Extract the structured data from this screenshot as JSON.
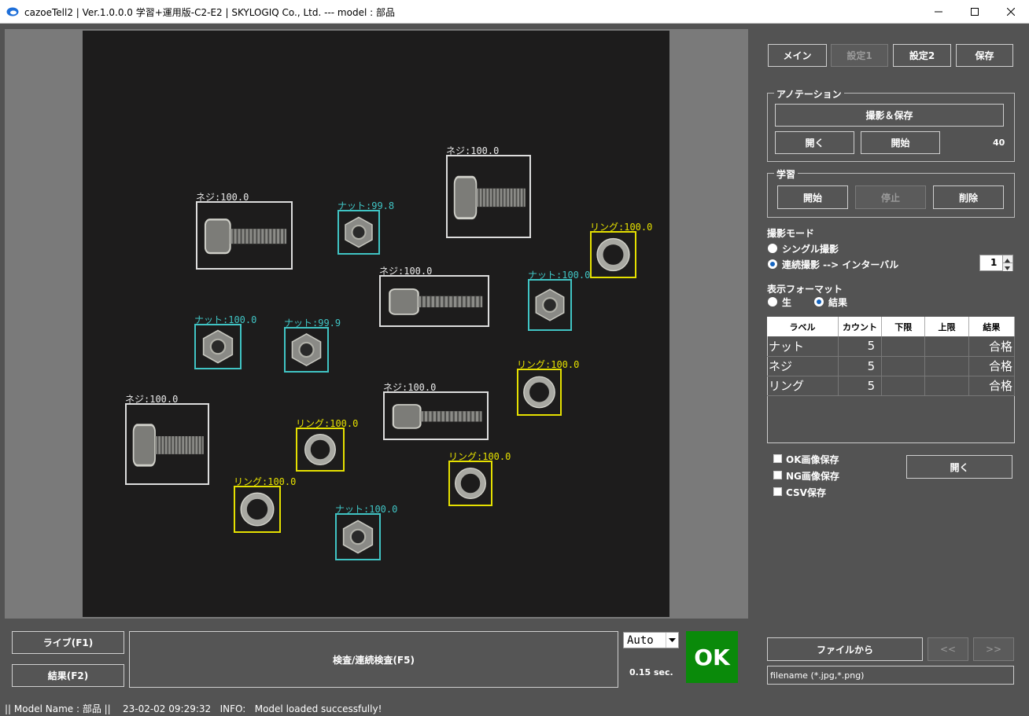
{
  "window": {
    "title": "cazoeTell2 | Ver.1.0.0.0 学習+運用版-C2-E2 | SKYLOGIQ Co., Ltd. --- model : 部品"
  },
  "detections": [
    {
      "label": "ネジ:100.0",
      "kind": "screw"
    },
    {
      "label": "ナット:99.8",
      "kind": "nut"
    },
    {
      "label": "ネジ:100.0",
      "kind": "screw"
    },
    {
      "label": "リング:100.0",
      "kind": "ring"
    },
    {
      "label": "ネジ:100.0",
      "kind": "screw"
    },
    {
      "label": "ナット:100.0",
      "kind": "nut"
    },
    {
      "label": "ナット:100.0",
      "kind": "nut"
    },
    {
      "label": "ナット:99.9",
      "kind": "nut"
    },
    {
      "label": "リング:100.0",
      "kind": "ring"
    },
    {
      "label": "ネジ:100.0",
      "kind": "screw"
    },
    {
      "label": "ネジ:100.0",
      "kind": "screw"
    },
    {
      "label": "リング:100.0",
      "kind": "ring"
    },
    {
      "label": "リング:100.0",
      "kind": "ring"
    },
    {
      "label": "リング:100.0",
      "kind": "ring"
    },
    {
      "label": "ナット:100.0",
      "kind": "nut"
    }
  ],
  "tabs": {
    "main": "メイン",
    "settings1": "設定1",
    "settings2": "設定2",
    "save": "保存"
  },
  "annotation": {
    "title": "アノテーション",
    "capture_save": "撮影＆保存",
    "open": "開く",
    "start": "開始",
    "count": "40"
  },
  "learning": {
    "title": "学習",
    "start": "開始",
    "stop": "停止",
    "delete": "削除"
  },
  "capture_mode": {
    "title": "撮影モード",
    "single": "シングル撮影",
    "continuous": "連続撮影 --> インターバル",
    "interval": "1",
    "selected": "continuous"
  },
  "display_format": {
    "title": "表示フォーマット",
    "raw": "生",
    "result": "結果",
    "selected": "result"
  },
  "results": {
    "headers": [
      "ラベル",
      "カウント",
      "下限",
      "上限",
      "結果"
    ],
    "rows": [
      [
        "ナット",
        "5",
        "",
        "",
        "合格"
      ],
      [
        "ネジ",
        "5",
        "",
        "",
        "合格"
      ],
      [
        "リング",
        "5",
        "",
        "",
        "合格"
      ]
    ]
  },
  "save_options": {
    "ok_image": "OK画像保存",
    "ng_image": "NG画像保存",
    "csv": "CSV保存",
    "open": "開く"
  },
  "bottom": {
    "live": "ライブ(F1)",
    "result": "結果(F2)",
    "inspect": "検査/連続検査(F5)",
    "mode": "Auto",
    "time": "0.15 sec.",
    "verdict": "OK",
    "verdict_color": "#0a8a0a"
  },
  "file": {
    "from_file": "ファイルから",
    "prev": "<<",
    "next": ">>",
    "filename_placeholder": "filename (*.jpg,*.png)"
  },
  "status": {
    "text": "|| Model Name : 部品 ||    23-02-02 09:29:32   INFO:   Model loaded successfully!"
  }
}
